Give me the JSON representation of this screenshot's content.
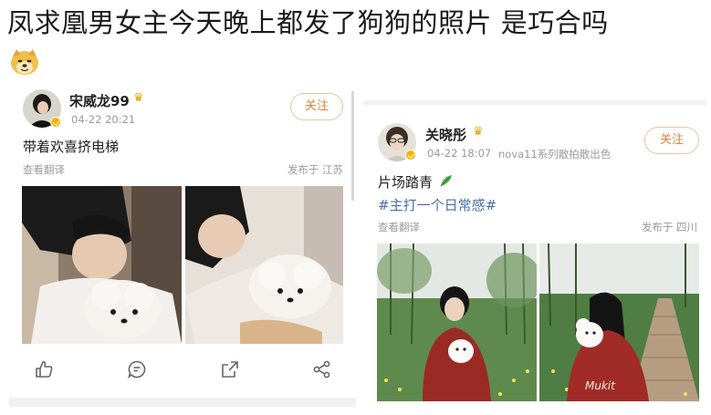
{
  "headline": "凤求凰男女主今天晚上都发了狗狗的照片 是巧合吗",
  "left_post": {
    "user_name": "宋威龙99",
    "timestamp": "04-22 20:21",
    "follow_label": "关注",
    "content": "带着欢喜挤电梯",
    "translate_label": "查看翻译",
    "location": "发布于 江苏",
    "actions": [
      "like-icon",
      "comment-icon",
      "share-icon",
      "more-icon"
    ]
  },
  "right_post": {
    "user_name": "关晓彤",
    "timestamp": "04-22 18:07",
    "device": "nova11系列散拍散出色",
    "follow_label": "关注",
    "content": "片场踏青",
    "topic": "#主打一个日常感#",
    "translate_label": "查看翻译",
    "location": "发布于 四川"
  },
  "colors": {
    "follow_text": "#e0823d",
    "topic_text": "#4a6ea8",
    "badge": "#f5b400"
  }
}
